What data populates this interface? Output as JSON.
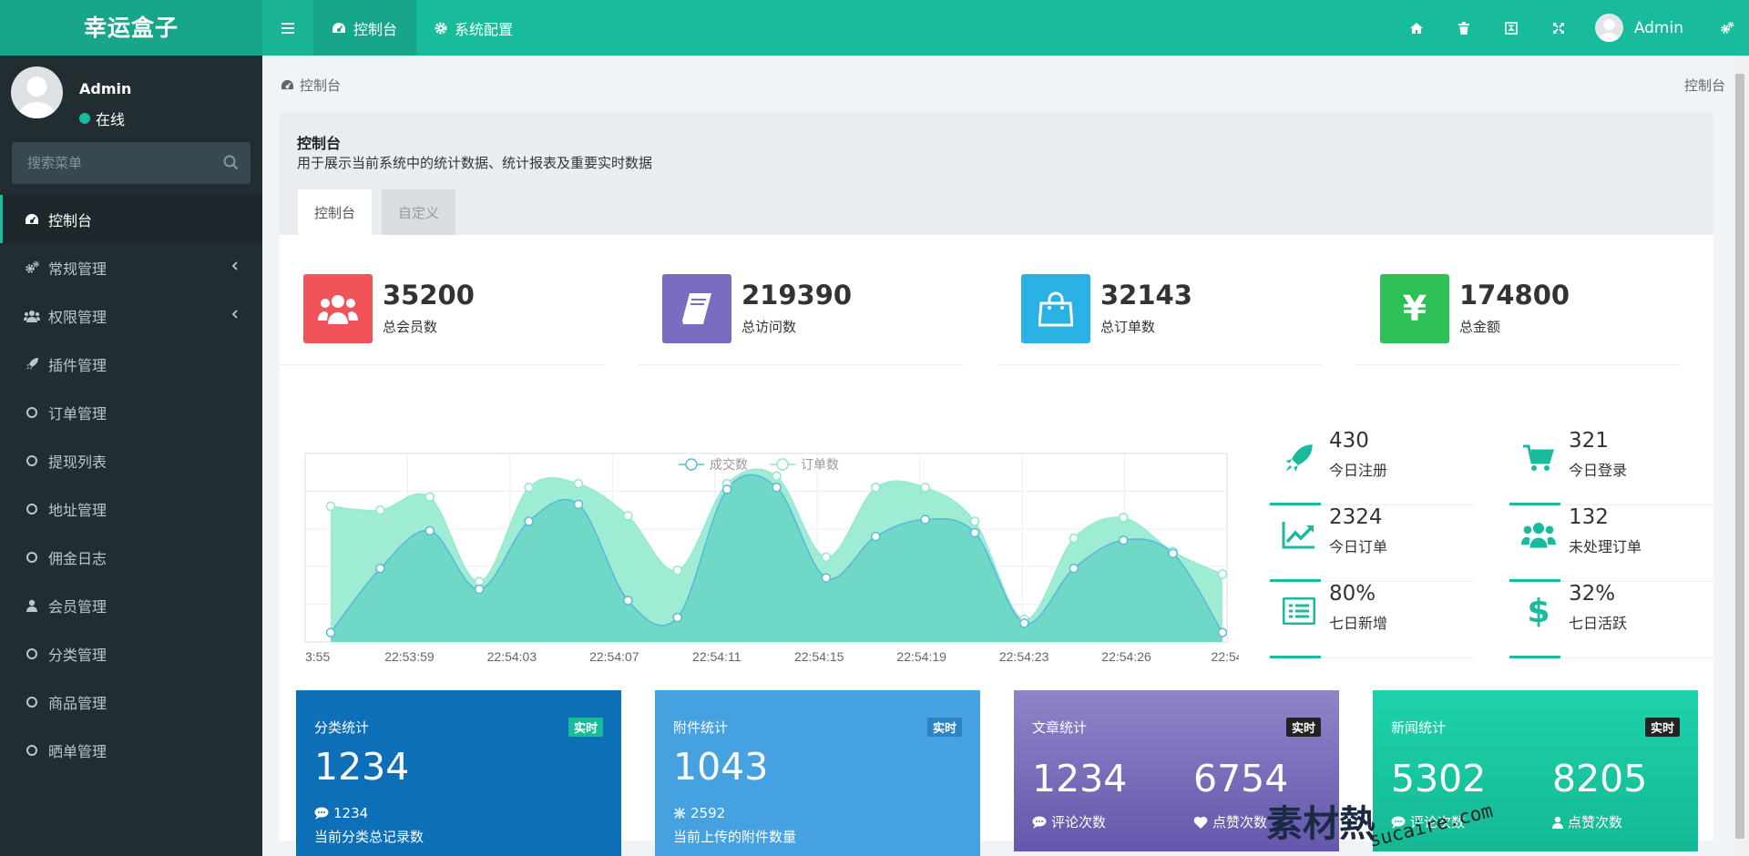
{
  "app": {
    "logo": "幸运盒子"
  },
  "topnav": {
    "tabs": [
      {
        "label": "控制台",
        "icon": "dashboard-icon"
      },
      {
        "label": "系统配置",
        "icon": "gear-icon"
      }
    ],
    "user_name": "Admin",
    "right_icons": [
      "home-icon",
      "trash-icon",
      "translate-icon",
      "fullscreen-icon",
      "settings-icon"
    ]
  },
  "sidebar": {
    "user": {
      "name": "Admin",
      "status": "在线"
    },
    "search_placeholder": "搜索菜单",
    "items": [
      {
        "label": "控制台",
        "icon": "dashboard-icon",
        "active": true
      },
      {
        "label": "常规管理",
        "icon": "cogs-icon",
        "has_children": true
      },
      {
        "label": "权限管理",
        "icon": "users-icon",
        "has_children": true
      },
      {
        "label": "插件管理",
        "icon": "rocket-icon"
      },
      {
        "label": "订单管理",
        "icon": "circle-icon"
      },
      {
        "label": "提现列表",
        "icon": "circle-icon"
      },
      {
        "label": "地址管理",
        "icon": "circle-icon"
      },
      {
        "label": "佣金日志",
        "icon": "circle-icon"
      },
      {
        "label": "会员管理",
        "icon": "user-icon"
      },
      {
        "label": "分类管理",
        "icon": "circle-icon"
      },
      {
        "label": "商品管理",
        "icon": "circle-icon"
      },
      {
        "label": "晒单管理",
        "icon": "circle-icon"
      }
    ]
  },
  "breadcrumb": {
    "label": "控制台",
    "right": "控制台"
  },
  "panel": {
    "title": "控制台",
    "description": "用于展示当前系统中的统计数据、统计报表及重要实时数据",
    "tabs": [
      "控制台",
      "自定义"
    ]
  },
  "stats": [
    {
      "value": "35200",
      "label": "总会员数",
      "color": "#f0535a",
      "icon": "users-icon"
    },
    {
      "value": "219390",
      "label": "总访问数",
      "color": "#7b6bc1",
      "icon": "book-icon"
    },
    {
      "value": "32143",
      "label": "总订单数",
      "color": "#2ab2e4",
      "icon": "shopping-bag-icon"
    },
    {
      "value": "174800",
      "label": "总金额",
      "color": "#2dc054",
      "icon": "yen-icon"
    }
  ],
  "chart_data": {
    "type": "area",
    "legend": [
      "成交数",
      "订单数"
    ],
    "x": [
      "3:55",
      "22:53:59",
      "22:54:03",
      "22:54:07",
      "22:54:11",
      "22:54:15",
      "22:54:19",
      "22:54:23",
      "22:54:26",
      "22:54:"
    ],
    "series": [
      {
        "name": "成交数",
        "color": "#5bb9da",
        "fill": "#6ad6c5",
        "values": [
          5,
          39,
          59,
          28,
          64,
          73,
          22,
          13,
          81,
          82,
          34,
          56,
          65,
          58,
          10,
          39,
          54,
          47,
          5
        ]
      },
      {
        "name": "订单数",
        "color": "#8de8cb",
        "fill": "#9aebd3",
        "values": [
          72,
          70,
          77,
          32,
          82,
          84,
          67,
          38,
          84,
          88,
          45,
          82,
          82,
          64,
          12,
          55,
          66,
          48,
          36
        ]
      }
    ]
  },
  "mini_stats": [
    {
      "value": "430",
      "label": "今日注册",
      "icon": "rocket-icon"
    },
    {
      "value": "321",
      "label": "今日登录",
      "icon": "cart-icon"
    },
    {
      "value": "2324",
      "label": "今日订单",
      "icon": "line-chart-icon"
    },
    {
      "value": "132",
      "label": "未处理订单",
      "icon": "users-icon"
    },
    {
      "value": "80%",
      "label": "七日新增",
      "icon": "list-icon"
    },
    {
      "value": "32%",
      "label": "七日活跃",
      "icon": "dollar-icon"
    }
  ],
  "cards": [
    {
      "title": "分类统计",
      "badge": "实时",
      "big": "1234",
      "sub_value": "1234",
      "sub_label": "当前分类总记录数",
      "bg": "#0d6fb8",
      "badge_bg": "#18bc9c"
    },
    {
      "title": "附件统计",
      "badge": "实时",
      "big": "1043",
      "sub_value": "2592",
      "sub_label": "当前上传的附件数量",
      "bg": "#46a1e0",
      "badge_bg": "#2c84c4"
    },
    {
      "title": "文章统计",
      "badge": "实时",
      "big1": "1234",
      "big2": "6754",
      "label1": "评论次数",
      "label2": "点赞次数",
      "bg": "#7a6fb8",
      "badge_bg": "#222"
    },
    {
      "title": "新闻统计",
      "badge": "实时",
      "big1": "5302",
      "big2": "8205",
      "label1": "评论次数",
      "label2": "点赞次数",
      "bg": "#19c9a0",
      "badge_bg": "#222"
    }
  ],
  "watermark": {
    "text1": "素材熱",
    "text2": "sucaire.com"
  }
}
